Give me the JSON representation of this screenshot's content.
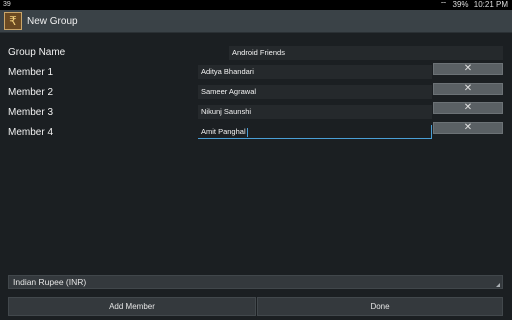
{
  "status": {
    "left_text": "39",
    "battery": "39%",
    "time": "10:21 PM"
  },
  "app": {
    "title": "New Group",
    "icon_glyph": "₹"
  },
  "form": {
    "group_name_label": "Group Name",
    "group_name_value": "Android Friends",
    "members": [
      {
        "label": "Member 1",
        "value": "Aditya Bhandari"
      },
      {
        "label": "Member 2",
        "value": "Sameer Agrawal"
      },
      {
        "label": "Member 3",
        "value": "Nikunj Saunshi"
      },
      {
        "label": "Member 4",
        "value": "Amit Panghal"
      }
    ],
    "remove_glyph": "✕"
  },
  "currency": {
    "selected": "Indian Rupee (INR)"
  },
  "buttons": {
    "add_member": "Add Member",
    "done": "Done"
  },
  "colors": {
    "background": "#1b1f22",
    "accent": "#4a9fd6",
    "actionbar": "#3a4247"
  }
}
